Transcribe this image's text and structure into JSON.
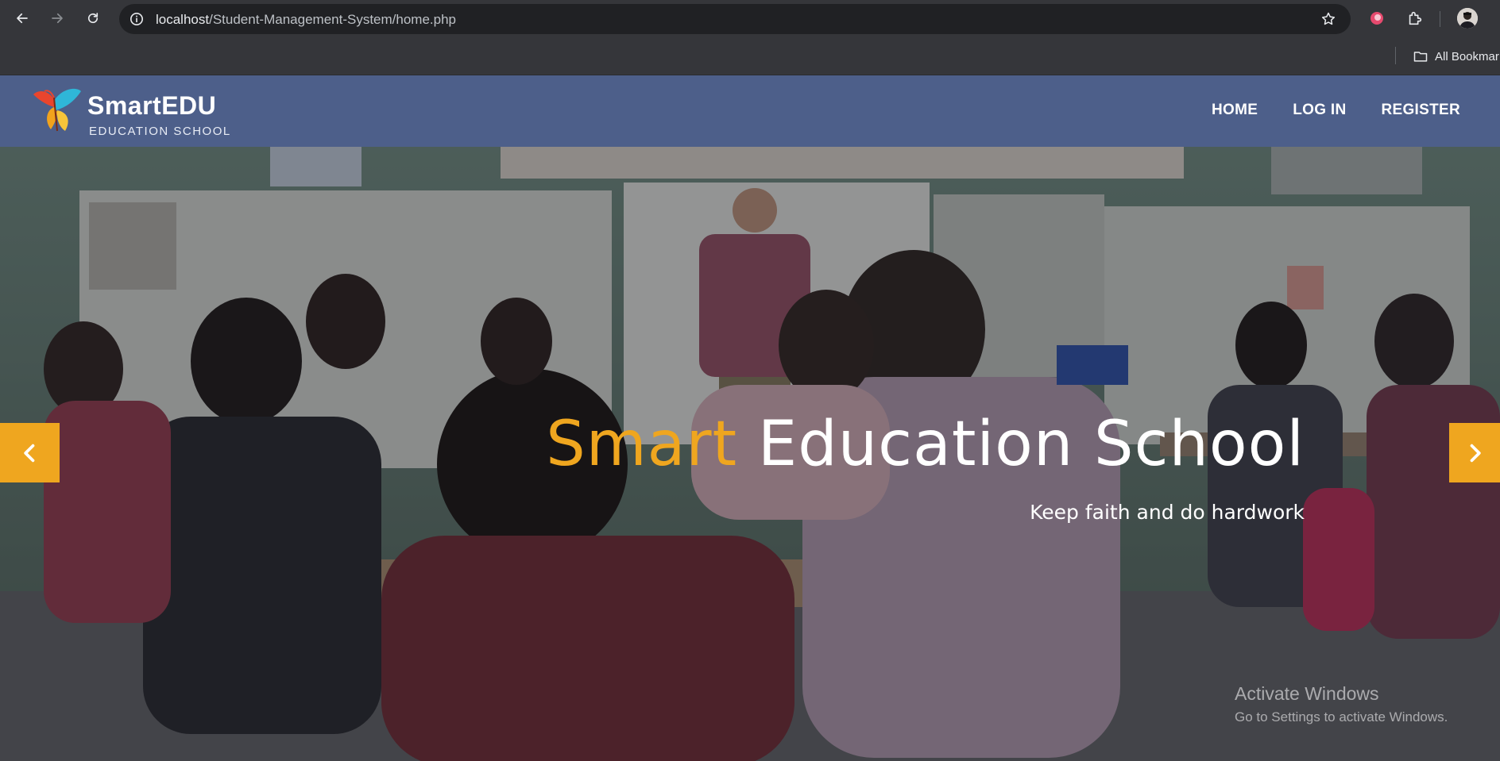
{
  "browser": {
    "url_host": "localhost",
    "url_path": "/Student-Management-System/home.php",
    "bookmarks_label": "All Bookmar"
  },
  "site": {
    "logo_title": "SmartEDU",
    "logo_subtitle": "EDUCATION SCHOOL",
    "nav": [
      "HOME",
      "LOG IN",
      "REGISTER"
    ]
  },
  "hero": {
    "title_accent": "Smart",
    "title_rest": " Education School",
    "subtitle": "Keep faith and do hardwork"
  },
  "windows_watermark": {
    "line1": "Activate Windows",
    "line2": "Go to Settings to activate Windows."
  },
  "colors": {
    "accent": "#efa61f",
    "header_bg": "#4d5f8a"
  }
}
